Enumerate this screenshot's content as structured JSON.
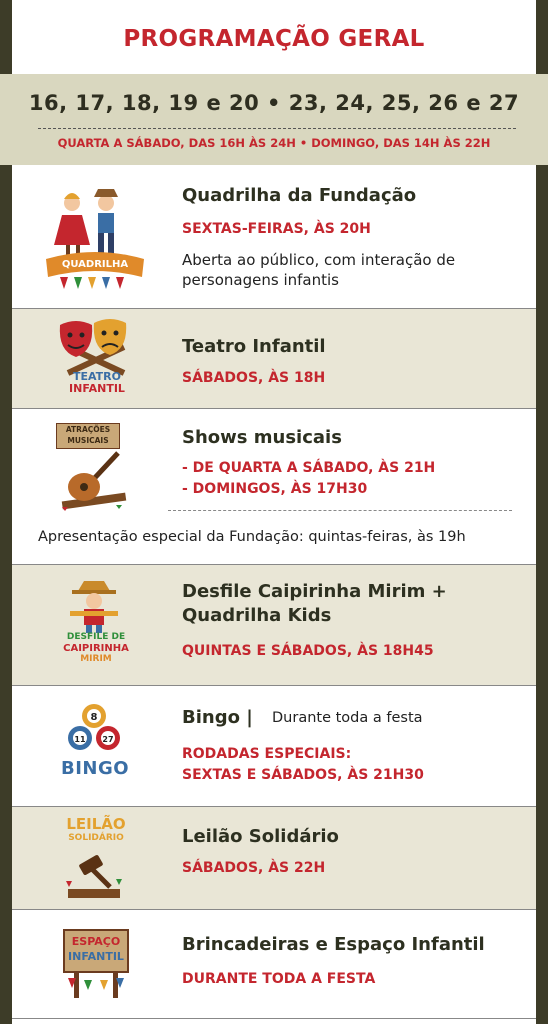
{
  "header": {
    "title": "PROGRAMAÇÃO GERAL",
    "dates": "16, 17, 18, 19 e 20  •  23, 24, 25, 26 e 27",
    "hours": "QUARTA A SÁBADO, DAS 16H ÀS 24H • DOMINGO, DAS 14H ÀS 22H"
  },
  "events": {
    "quadrilha": {
      "icon_label": "QUADRILHA",
      "icon": "dancing-couple-icon",
      "title": "Quadrilha da Fundação",
      "schedule": "SEXTAS-FEIRAS, ÀS 20H",
      "desc_line1": "Aberta ao público, com interação de",
      "desc_line2": "personagens infantis"
    },
    "teatro": {
      "icon_label_1": "TEATRO",
      "icon_label_2": "INFANTIL",
      "icon": "theater-masks-icon",
      "title": "Teatro Infantil",
      "schedule": "SÁBADOS, ÀS 18H"
    },
    "shows": {
      "icon_label_1": "ATRAÇÕES",
      "icon_label_2": "MUSICAIS",
      "icon": "guitar-icon",
      "title": "Shows musicais",
      "schedule_1": "- DE QUARTA A SÁBADO, ÀS 21H",
      "schedule_2": "- DOMINGOS, ÀS 17H30",
      "note": "Apresentação especial da Fundação: quintas-feiras, às 19h"
    },
    "desfile": {
      "icon_label_1": "DESFILE DE",
      "icon_label_2": "CAIPIRINHA",
      "icon_label_3": "MIRIM",
      "icon": "scarecrow-icon",
      "title_1": "Desfile Caipirinha Mirim +",
      "title_2": "Quadrilha Kids",
      "schedule": "QUINTAS E SÁBADOS, ÀS 18H45"
    },
    "bingo": {
      "icon_label": "BINGO",
      "ball_1": "8",
      "ball_2": "11",
      "ball_3": "27",
      "icon": "bingo-balls-icon",
      "title": "Bingo |",
      "title_note": "Durante toda a festa",
      "schedule_1": "RODADAS ESPECIAIS:",
      "schedule_2": "SEXTAS E SÁBADOS, ÀS 21H30"
    },
    "leilao": {
      "icon_label_1": "LEILÃO",
      "icon_label_2": "SOLIDÁRIO",
      "icon": "gavel-icon",
      "title": "Leilão Solidário",
      "schedule": "SÁBADOS, ÀS 22H"
    },
    "brincadeiras": {
      "icon_label_1": "ESPAÇO",
      "icon_label_2": "INFANTIL",
      "icon": "wooden-sign-icon",
      "title": "Brincadeiras e Espaço Infantil",
      "schedule": "DURANTE TODA A FESTA"
    }
  },
  "colors": {
    "accent_red": "#c4262e",
    "frame": "#3d3c28",
    "band": "#d9d7bf",
    "shaded": "#e9e6d6"
  }
}
